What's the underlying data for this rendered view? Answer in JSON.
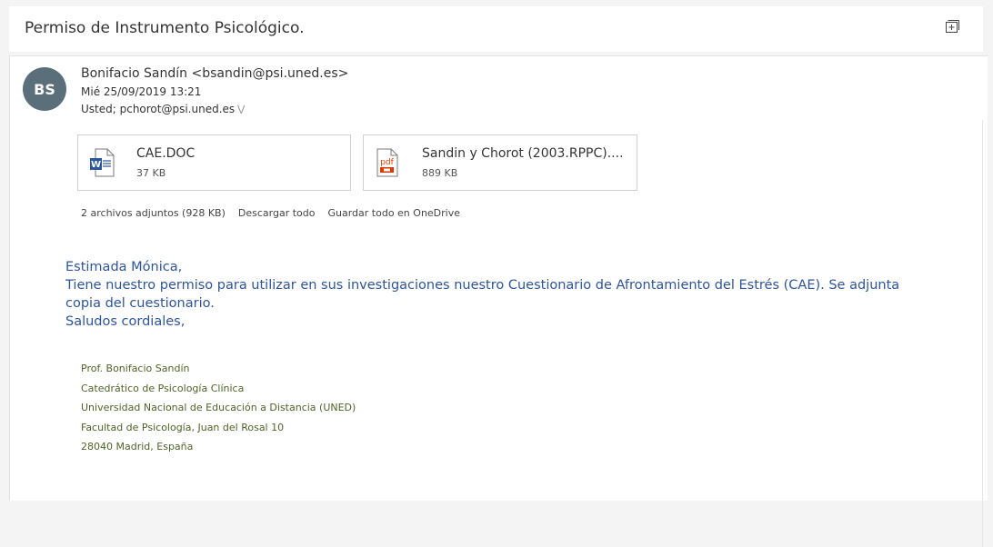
{
  "subject": "Permiso de Instrumento Psicológico.",
  "avatar_initials": "BS",
  "sender": "Bonifacio Sandín <bsandin@psi.uned.es>",
  "date": "Mié 25/09/2019 13:21",
  "recipients": "Usted; pchorot@psi.uned.es",
  "attachments": [
    {
      "name": "CAE.DOC",
      "size": "37 KB",
      "icon": "word-doc-icon"
    },
    {
      "name": "Sandin y Chorot (2003.RPPC)....",
      "size": "889 KB",
      "icon": "pdf-icon"
    }
  ],
  "attachment_summary": "2 archivos adjuntos (928 KB)",
  "download_all": "Descargar todo",
  "save_onedrive": "Guardar todo en OneDrive",
  "body": {
    "greeting": "Estimada Mónica,",
    "paragraph": "Tiene nuestro permiso para utilizar en sus investigaciones nuestro Cuestionario de Afrontamiento del Estrés (CAE). Se adjunta copia del cuestionario.",
    "closing": "Saludos cordiales,"
  },
  "signature": [
    "Prof. Bonifacio Sandín",
    "Catedrático de Psicología Clínica",
    "Universidad Nacional de Educación a Distancia (UNED)",
    "Facultad de Psicología, Juan del Rosal 10",
    "28040 Madrid, España"
  ],
  "colors": {
    "body_text": "#2f5597",
    "signature_text": "#4f6228",
    "avatar_bg": "#5b6f7a",
    "word_blue": "#2b579a",
    "pdf_red": "#d83b01"
  }
}
